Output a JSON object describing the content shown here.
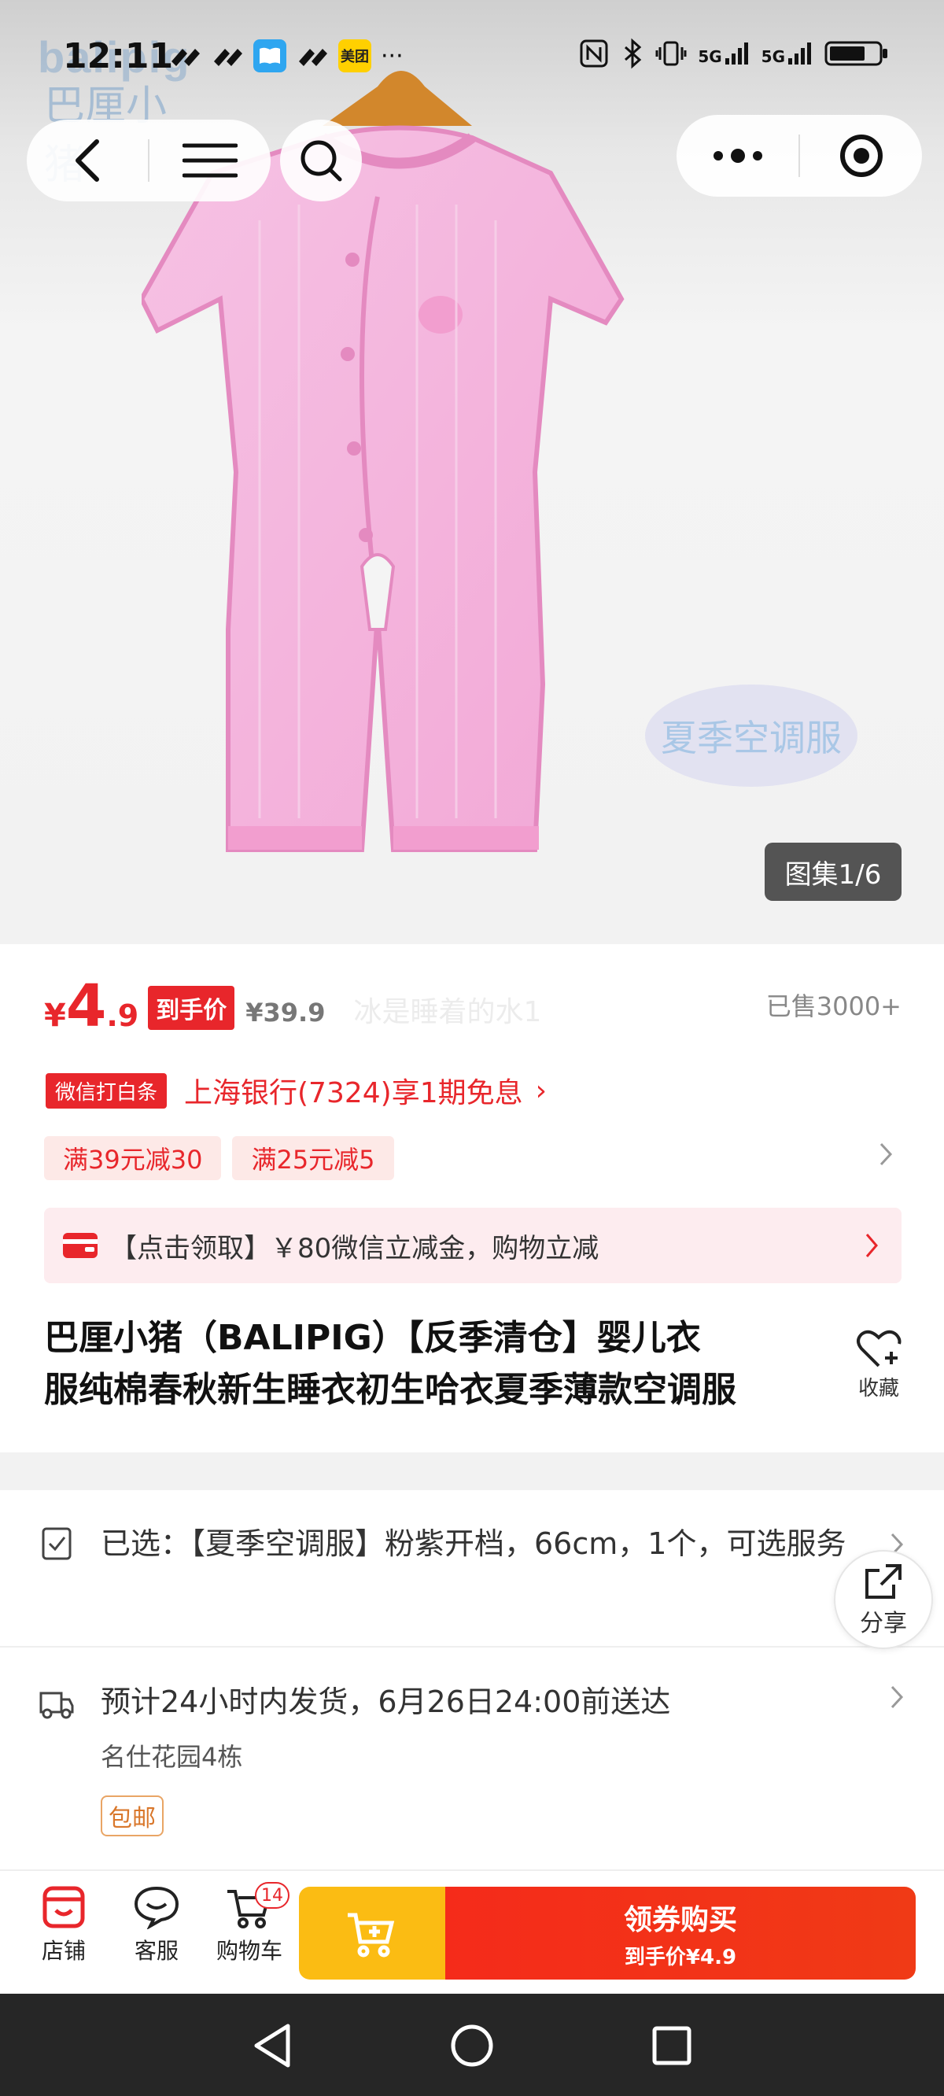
{
  "status_bar": {
    "time": "12:11",
    "more": "···",
    "meituan_label": "美团",
    "signal_5g_1": "5G",
    "signal_5g_2": "5G"
  },
  "hero": {
    "brand_logo_en": "balipig",
    "brand_logo_cn": "巴厘小猪",
    "season_tag": "夏季空调服",
    "gallery_badge": "图集1/6"
  },
  "product": {
    "price_currency": "¥",
    "price_integer": "4",
    "price_decimal": ".9",
    "price_tag": "到手价",
    "original_price": "¥39.9",
    "watermark_text": "冰是睡着的水1",
    "sold": "已售3000+",
    "wechat_tag": "微信打白条",
    "bank_offer": "上海银行(7324)享1期免息",
    "bank_arrow": "›",
    "coupons": [
      "满39元减30",
      "满25元减5"
    ],
    "claim_text": "【点击领取】￥80微信立减金，购物立减",
    "title_line1": "巴厘小猪（BALIPIG）【反季清仓】婴儿衣",
    "title_line2": "服纯棉春秋新生睡衣初生哈衣夏季薄款空调服",
    "favorite_label": "收藏"
  },
  "selection": {
    "text": "已选：【夏季空调服】粉紫开档，66cm，1个，可选服务",
    "share_label": "分享"
  },
  "shipping": {
    "text": "预计24小时内发货，6月26日24:00前送达",
    "address": "名仕花园4栋",
    "free_ship": "包邮"
  },
  "action_bar": {
    "store_label": "店铺",
    "service_label": "客服",
    "cart_label": "购物车",
    "cart_count": "14",
    "buy_main": "领券购买",
    "buy_sub": "到手价¥4.9"
  },
  "colors": {
    "accent_red": "#e8262b",
    "cart_yellow": "#fbbc13",
    "garment_pink": "#f6b6dc"
  }
}
